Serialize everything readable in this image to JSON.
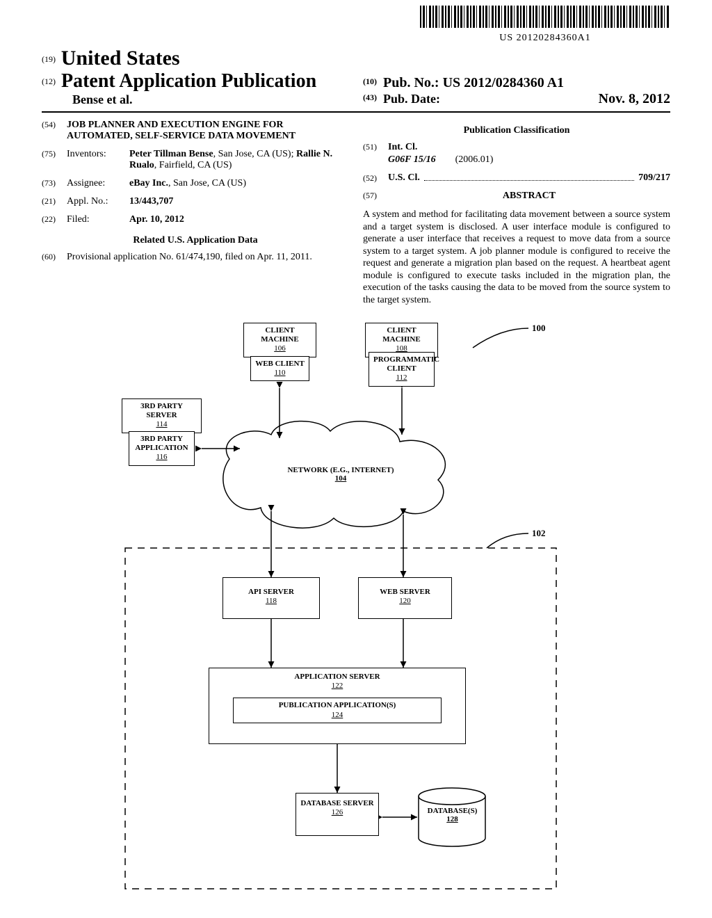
{
  "barcode_text": "US 20120284360A1",
  "header": {
    "country_code": "(19)",
    "country": "United States",
    "kind_code": "(12)",
    "kind_label": "Patent Application Publication",
    "authors": "Bense et al.",
    "pub_no_code": "(10)",
    "pub_no_label": "Pub. No.:",
    "pub_no": "US 2012/0284360 A1",
    "pub_date_code": "(43)",
    "pub_date_label": "Pub. Date:",
    "pub_date": "Nov. 8, 2012"
  },
  "left_col": {
    "title_code": "(54)",
    "title": "JOB PLANNER AND EXECUTION ENGINE FOR AUTOMATED, SELF-SERVICE DATA MOVEMENT",
    "inventors_code": "(75)",
    "inventors_label": "Inventors:",
    "inventors_value_1": "Peter Tillman Bense",
    "inventors_loc_1": ", San Jose, CA (US); ",
    "inventors_value_2": "Rallie N. Rualo",
    "inventors_loc_2": ", Fairfield, CA (US)",
    "assignee_code": "(73)",
    "assignee_label": "Assignee:",
    "assignee_value": "eBay Inc.",
    "assignee_loc": ", San Jose, CA (US)",
    "appl_code": "(21)",
    "appl_label": "Appl. No.:",
    "appl_value": "13/443,707",
    "filed_code": "(22)",
    "filed_label": "Filed:",
    "filed_value": "Apr. 10, 2012",
    "related_heading": "Related U.S. Application Data",
    "prov_code": "(60)",
    "prov_text": "Provisional application No. 61/474,190, filed on Apr. 11, 2011."
  },
  "right_col": {
    "classification_heading": "Publication Classification",
    "intcl_code": "(51)",
    "intcl_label": "Int. Cl.",
    "intcl_class": "G06F 15/16",
    "intcl_date": "(2006.01)",
    "uscl_code": "(52)",
    "uscl_label": "U.S. Cl.",
    "uscl_value": "709/217",
    "abstract_code": "(57)",
    "abstract_heading": "ABSTRACT",
    "abstract_text": "A system and method for facilitating data movement between a source system and a target system is disclosed. A user interface module is configured to generate a user interface that receives a request to move data from a source system to a target system. A job planner module is configured to receive the request and generate a migration plan based on the request. A heartbeat agent module is configured to execute tasks included in the migration plan, the execution of the tasks causing the data to be moved from the source system to the target system."
  },
  "figure": {
    "ref_100": "100",
    "ref_102": "102",
    "client_machine_1": "CLIENT MACHINE",
    "client_machine_1_num": "106",
    "web_client": "WEB CLIENT",
    "web_client_num": "110",
    "client_machine_2": "CLIENT MACHINE",
    "client_machine_2_num": "108",
    "prog_client": "PROGRAMMATIC CLIENT",
    "prog_client_num": "112",
    "third_party_server": "3RD PARTY SERVER",
    "third_party_server_num": "114",
    "third_party_app": "3RD PARTY APPLICATION",
    "third_party_app_num": "116",
    "network": "NETWORK (E.G., INTERNET)",
    "network_num": "104",
    "api_server": "API SERVER",
    "api_server_num": "118",
    "web_server": "WEB SERVER",
    "web_server_num": "120",
    "app_server": "APPLICATION SERVER",
    "app_server_num": "122",
    "pub_apps": "PUBLICATION APPLICATION(S)",
    "pub_apps_num": "124",
    "db_server": "DATABASE SERVER",
    "db_server_num": "126",
    "databases": "DATABASE(S)",
    "databases_num": "128"
  }
}
